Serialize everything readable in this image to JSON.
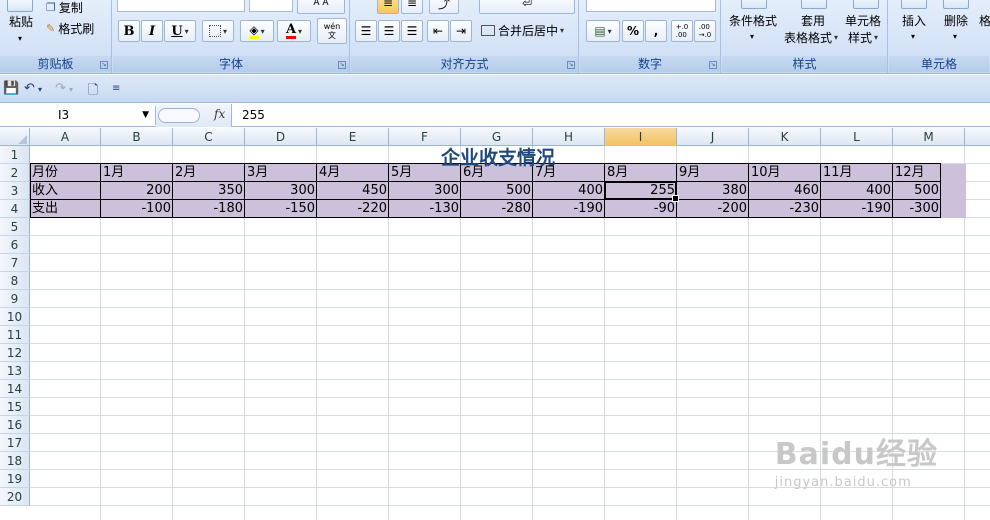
{
  "ribbon": {
    "clipboard": {
      "paste": "粘贴",
      "copy": "复制",
      "format_painter": "格式刷",
      "label": "剪贴板"
    },
    "font": {
      "label": "字体",
      "font_name": "",
      "font_size": "",
      "bold": "B",
      "italic": "I",
      "underline": "U",
      "wen": "wén\n文"
    },
    "alignment": {
      "label": "对齐方式",
      "merge": "合并后居中"
    },
    "number": {
      "label": "数字",
      "percent": "%",
      "comma": ",",
      "inc_decimal": "+.0\n.00",
      "dec_decimal": ".00\n→.0"
    },
    "styles": {
      "label": "样式",
      "conditional": "条件格式",
      "table_line1": "套用",
      "table_line2": "表格格式",
      "cell_line1": "单元格",
      "cell_line2": "样式"
    },
    "cells": {
      "label": "单元格",
      "insert": "插入",
      "delete": "删除",
      "format": "格"
    }
  },
  "formula_bar": {
    "name_box": "I3",
    "fx": "fx",
    "value": "255"
  },
  "columns": [
    "A",
    "B",
    "C",
    "D",
    "E",
    "F",
    "G",
    "H",
    "I",
    "J",
    "K",
    "L",
    "M"
  ],
  "selected_column": "I",
  "rows": [
    "1",
    "2",
    "3",
    "4",
    "5",
    "6",
    "7",
    "8",
    "9",
    "10",
    "11",
    "12",
    "13",
    "14",
    "15",
    "16",
    "17",
    "18",
    "19",
    "20"
  ],
  "sheet": {
    "title": "企业收支情况",
    "header_row": [
      "月份",
      "1月",
      "2月",
      "3月",
      "4月",
      "5月",
      "6月",
      "7月",
      "8月",
      "9月",
      "10月",
      "11月",
      "12月"
    ],
    "income": {
      "label": "收入",
      "values": [
        "200",
        "350",
        "300",
        "450",
        "300",
        "500",
        "400",
        "255",
        "380",
        "460",
        "400",
        "500"
      ]
    },
    "expense": {
      "label": "支出",
      "values": [
        "-100",
        "-180",
        "-150",
        "-220",
        "-130",
        "-280",
        "-190",
        "-90",
        "-200",
        "-230",
        "-190",
        "-300"
      ]
    },
    "band_color": "#ccc0da",
    "title_color": "#1f497d"
  },
  "watermark": {
    "brand": "Baidu经验",
    "url": "jingyan.baidu.com"
  }
}
